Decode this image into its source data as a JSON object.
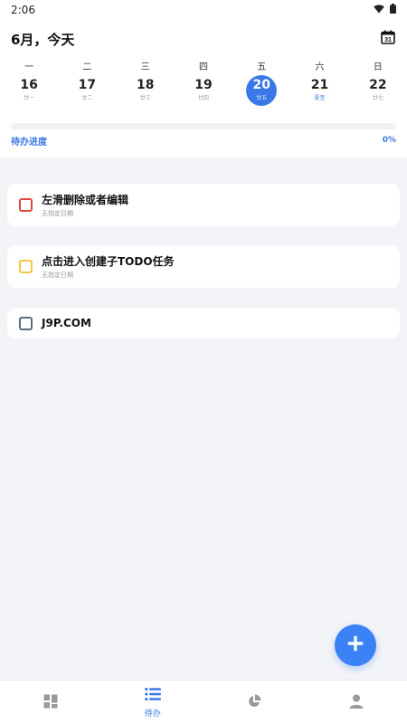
{
  "status_bar": {
    "time": "2:06",
    "icons": [
      "wifi-icon",
      "battery-icon"
    ]
  },
  "header": {
    "month_title": "6月，今天",
    "calendar_icon": "calendar-icon"
  },
  "week": {
    "weekdays": [
      "一",
      "二",
      "三",
      "四",
      "五",
      "六",
      "日"
    ],
    "days": [
      {
        "num": "16",
        "lunar": "廿一"
      },
      {
        "num": "17",
        "lunar": "廿二"
      },
      {
        "num": "18",
        "lunar": "廿三"
      },
      {
        "num": "19",
        "lunar": "廿四"
      },
      {
        "num": "20",
        "lunar": "廿五"
      },
      {
        "num": "21",
        "lunar": "夏至"
      },
      {
        "num": "22",
        "lunar": "廿七"
      }
    ],
    "selected_index": 4
  },
  "progress": {
    "label": "待办进度",
    "value_text": "0%",
    "fraction": 0
  },
  "tasks": [
    {
      "title": "左滑删除或者编辑",
      "subtitle": "无指定日期",
      "color": "#e0483e"
    },
    {
      "title": "点击进入创建子TODO任务",
      "subtitle": "无指定日期",
      "color": "#f4c542"
    },
    {
      "title": "J9P.COM",
      "subtitle": "",
      "color": "#5b6b7b"
    }
  ],
  "fab": {
    "icon": "plus-icon"
  },
  "bottom_nav": {
    "items": [
      {
        "icon": "dashboard-icon",
        "label": ""
      },
      {
        "icon": "list-icon",
        "label": "待办"
      },
      {
        "icon": "pie-chart-icon",
        "label": ""
      },
      {
        "icon": "profile-icon",
        "label": ""
      }
    ],
    "active_index": 1
  },
  "colors": {
    "accent": "#3b78e7",
    "background": "#f3f4f7"
  }
}
